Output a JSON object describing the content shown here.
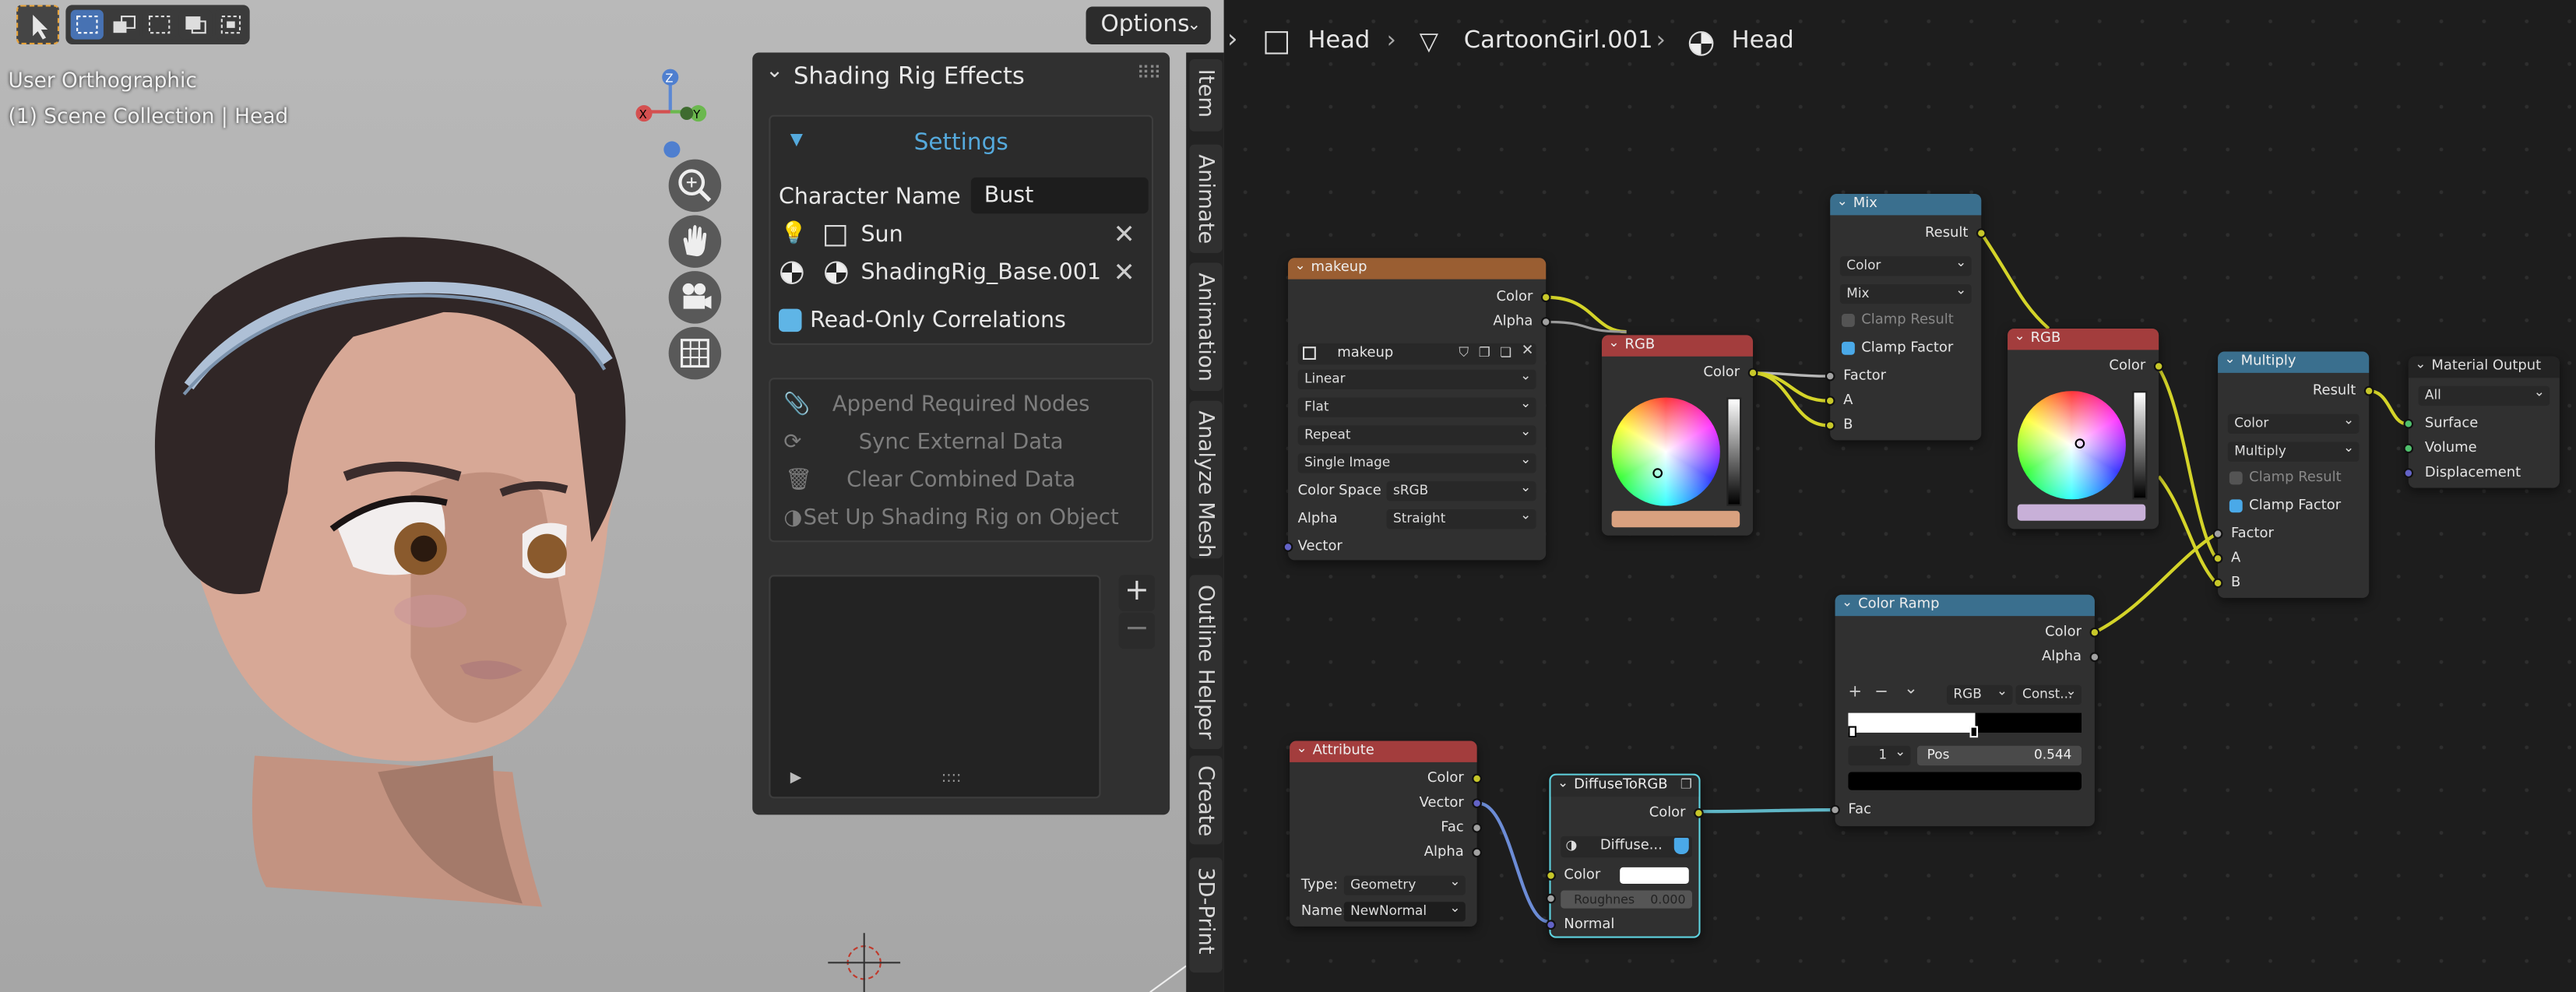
{
  "viewport": {
    "overlay_view": "User Orthographic",
    "overlay_collection": "(1) Scene Collection | Head",
    "options_label": "Options"
  },
  "sidebar": {
    "title": "Shading Rig Effects",
    "settings_label": "Settings",
    "character_name_label": "Character Name",
    "character_name_value": "Bust",
    "light_item": "Sun",
    "material_item": "ShadingRig_Base.001",
    "readonly_label": "Read-Only Correlations",
    "actions": [
      "Append Required Nodes",
      "Sync External Data",
      "Clear Combined Data",
      "Set Up Shading Rig on Object"
    ],
    "tabs": [
      "Item",
      "Animate",
      "Animation",
      "Analyze Mesh",
      "Outline Helper",
      "Create",
      "3D-Print"
    ]
  },
  "breadcrumb": {
    "item1": "Head",
    "item2": "CartoonGirl.001",
    "item3": "Head"
  },
  "nodes": {
    "makeup": {
      "title": "makeup",
      "out_color": "Color",
      "out_alpha": "Alpha",
      "image_name": "makeup",
      "interp": "Linear",
      "proj": "Flat",
      "ext": "Repeat",
      "source": "Single Image",
      "colorspace_label": "Color Space",
      "colorspace_value": "sRGB",
      "alpha_label": "Alpha",
      "alpha_value": "Straight",
      "in_vector": "Vector"
    },
    "rgb1": {
      "title": "RGB",
      "out_color": "Color"
    },
    "mix": {
      "title": "Mix",
      "out_result": "Result",
      "data_type": "Color",
      "blend": "Mix",
      "clamp_result": "Clamp Result",
      "clamp_factor": "Clamp Factor",
      "in_factor": "Factor",
      "in_a": "A",
      "in_b": "B"
    },
    "rgb2": {
      "title": "RGB",
      "out_color": "Color"
    },
    "multiply": {
      "title": "Multiply",
      "out_result": "Result",
      "data_type": "Color",
      "blend": "Multiply",
      "clamp_result": "Clamp Result",
      "clamp_factor": "Clamp Factor",
      "in_factor": "Factor",
      "in_a": "A",
      "in_b": "B"
    },
    "output": {
      "title": "Material Output",
      "target": "All",
      "in_surface": "Surface",
      "in_volume": "Volume",
      "in_displacement": "Displacement"
    },
    "ramp": {
      "title": "Color Ramp",
      "out_color": "Color",
      "out_alpha": "Alpha",
      "mode": "RGB",
      "interp": "Const...",
      "index": "1",
      "pos_label": "Pos",
      "pos_value": "0.544",
      "in_fac": "Fac"
    },
    "attribute": {
      "title": "Attribute",
      "out_color": "Color",
      "out_vector": "Vector",
      "out_fac": "Fac",
      "out_alpha": "Alpha",
      "type_label": "Type:",
      "type_value": "Geometry",
      "name_label": "Name:",
      "name_value": "NewNormal"
    },
    "diffuse": {
      "title": "DiffuseToRGB",
      "out_color": "Color",
      "group_name": "Diffuse...",
      "in_color": "Color",
      "in_roughness": "Roughnes",
      "roughness_value": "0.000",
      "in_normal": "Normal"
    }
  },
  "colors": {
    "rgb1_swatch": "#d9a17f",
    "rgb2_swatch": "#c8b0d8",
    "accent": "#4772b3",
    "header_texture": "#9a5e32",
    "header_color": "#a33d3d",
    "header_converter": "#3a6f8e"
  }
}
